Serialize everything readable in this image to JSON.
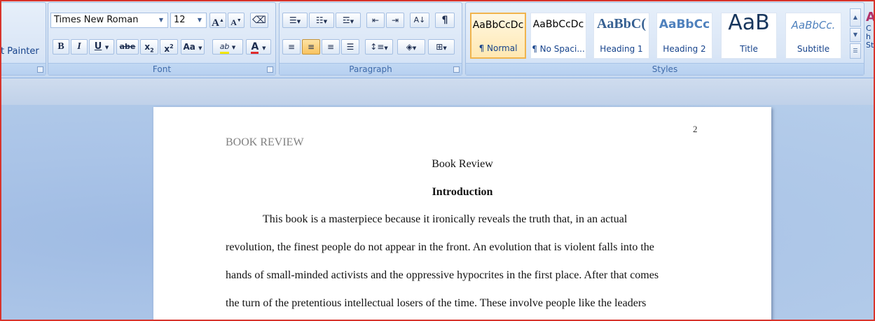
{
  "clipboard": {
    "format_painter_label": "t Painter"
  },
  "font": {
    "group_label": "Font",
    "font_name": "Times New Roman",
    "font_size": "12",
    "grow_label": "A",
    "shrink_label": "A",
    "bold_label": "B",
    "italic_label": "I",
    "underline_label": "U",
    "strike_label": "abe",
    "subscript_label": "x",
    "superscript_label": "x",
    "case_label": "Aa",
    "highlight_label": "ab",
    "color_label": "A"
  },
  "paragraph": {
    "group_label": "Paragraph",
    "pilcrow": "¶"
  },
  "styles": {
    "group_label": "Styles",
    "items": [
      {
        "preview": "AaBbCcDc",
        "name": "¶ Normal"
      },
      {
        "preview": "AaBbCcDc",
        "name": "¶ No Spaci..."
      },
      {
        "preview": "AaBbC(",
        "name": "Heading 1"
      },
      {
        "preview": "AaBbCc",
        "name": "Heading 2"
      },
      {
        "preview": "AaB",
        "name": "Title"
      },
      {
        "preview": "AaBbCc.",
        "name": "Subtitle"
      }
    ],
    "change_styles_label": "Ch St"
  },
  "document": {
    "page_number": "2",
    "running_head": "BOOK REVIEW",
    "title": "Book Review",
    "heading": "Introduction",
    "lines": [
      "This book is a masterpiece because it ironically reveals the truth that, in an actual",
      "revolution, the finest people do not appear in the front. An evolution that is violent falls into the",
      "hands of small-minded activists and the oppressive hypocrites in the first place. After that comes",
      "the turn of the pretentious intellectual losers of the time. These involve people like the leaders"
    ]
  },
  "colors": {
    "accent": "#15428b",
    "selected_style": "#f0b44d",
    "font_color": "#e02b2b",
    "highlight": "#f2e600"
  }
}
